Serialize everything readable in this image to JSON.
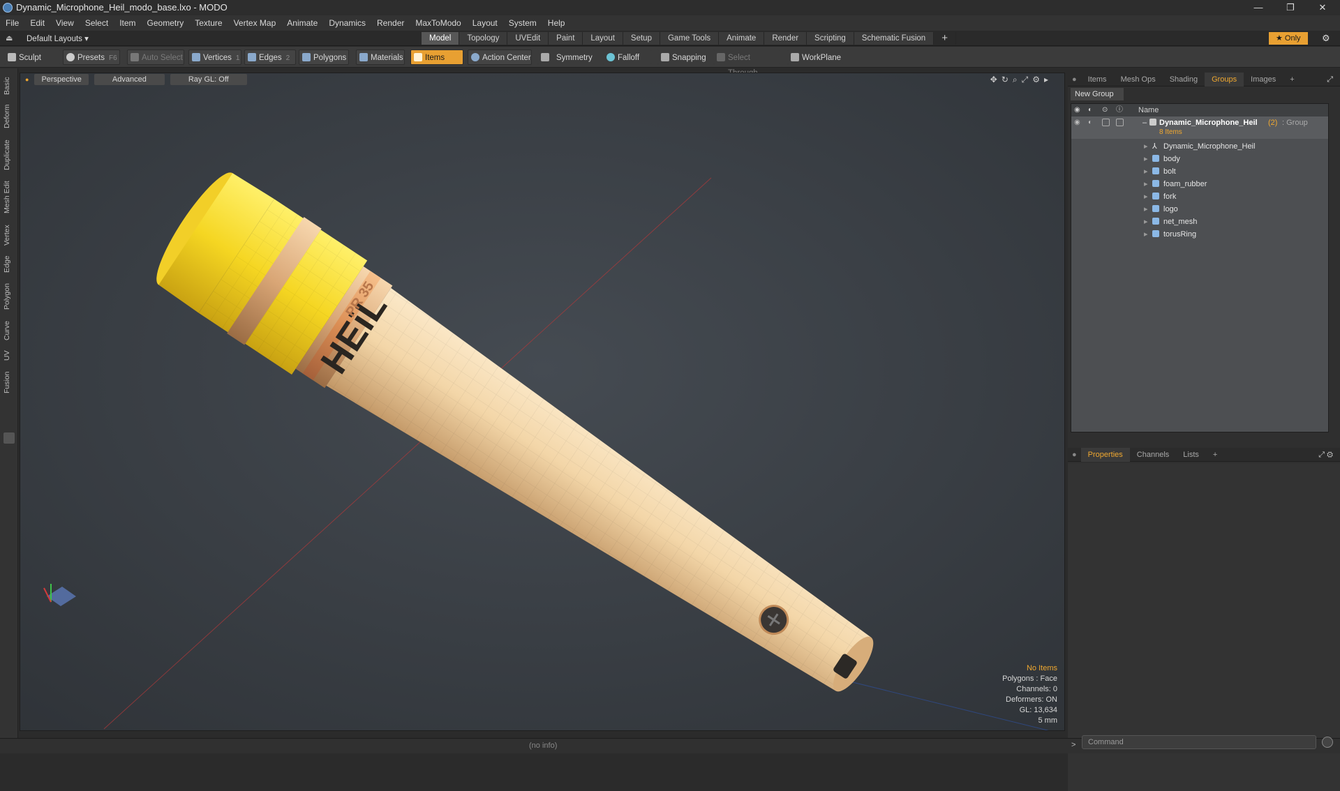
{
  "window": {
    "title": "Dynamic_Microphone_Heil_modo_base.lxo - MODO",
    "minimize": "—",
    "maximize": "❐",
    "close": "✕"
  },
  "menu": [
    "File",
    "Edit",
    "View",
    "Select",
    "Item",
    "Geometry",
    "Texture",
    "Vertex Map",
    "Animate",
    "Dynamics",
    "Render",
    "MaxToModo",
    "Layout",
    "System",
    "Help"
  ],
  "layout": {
    "preset": "Default Layouts ▾",
    "tabs": [
      "Model",
      "Topology",
      "UVEdit",
      "Paint",
      "Layout",
      "Setup",
      "Game Tools",
      "Animate",
      "Render",
      "Scripting",
      "Schematic Fusion"
    ],
    "active": "Model",
    "add": "+",
    "only": "★  Only"
  },
  "toolbar": {
    "sculpt": "Sculpt",
    "presets": "Presets",
    "presets_key": "F6",
    "auto_select": "Auto Select",
    "vertices": "Vertices",
    "vertices_count": "1",
    "edges": "Edges",
    "edges_count": "2",
    "polygons": "Polygons",
    "materials": "Materials",
    "items": "Items",
    "action_center": "Action Center",
    "symmetry": "Symmetry",
    "falloff": "Falloff",
    "snapping": "Snapping",
    "select_through": "Select Through",
    "workplane": "WorkPlane"
  },
  "left_tabs": [
    "Basic",
    "Deform",
    "Duplicate",
    "Mesh Edit",
    "Vertex",
    "Edge",
    "Polygon",
    "Curve",
    "UV",
    "Fusion"
  ],
  "viewport": {
    "view": "Perspective",
    "mode": "Advanced",
    "raygl": "Ray GL: Off",
    "info": {
      "items": "No Items",
      "polygons": "Polygons : Face",
      "channels": "Channels: 0",
      "deformers": "Deformers: ON",
      "gl": "GL: 13,634",
      "scale": "5 mm"
    },
    "logo_text": "HEiL",
    "model_text": "PR 35"
  },
  "panel_top": {
    "tabs": [
      "Items",
      "Mesh Ops",
      "Shading",
      "Groups",
      "Images"
    ],
    "active": "Groups",
    "add": "+",
    "new_group": "New Group",
    "column_name": "Name",
    "group": {
      "name": "Dynamic_Microphone_Heil",
      "count": "(2)",
      "type": ": Group",
      "sub": "8 Items"
    },
    "items": [
      "Dynamic_Microphone_Heil",
      "body",
      "bolt",
      "foam_rubber",
      "fork",
      "logo",
      "net_mesh",
      "torusRing"
    ]
  },
  "panel_bottom": {
    "tabs": [
      "Properties",
      "Channels",
      "Lists"
    ],
    "active": "Properties",
    "add": "+"
  },
  "status": {
    "info": "(no info)",
    "command_placeholder": "Command",
    "prompt": ">"
  }
}
